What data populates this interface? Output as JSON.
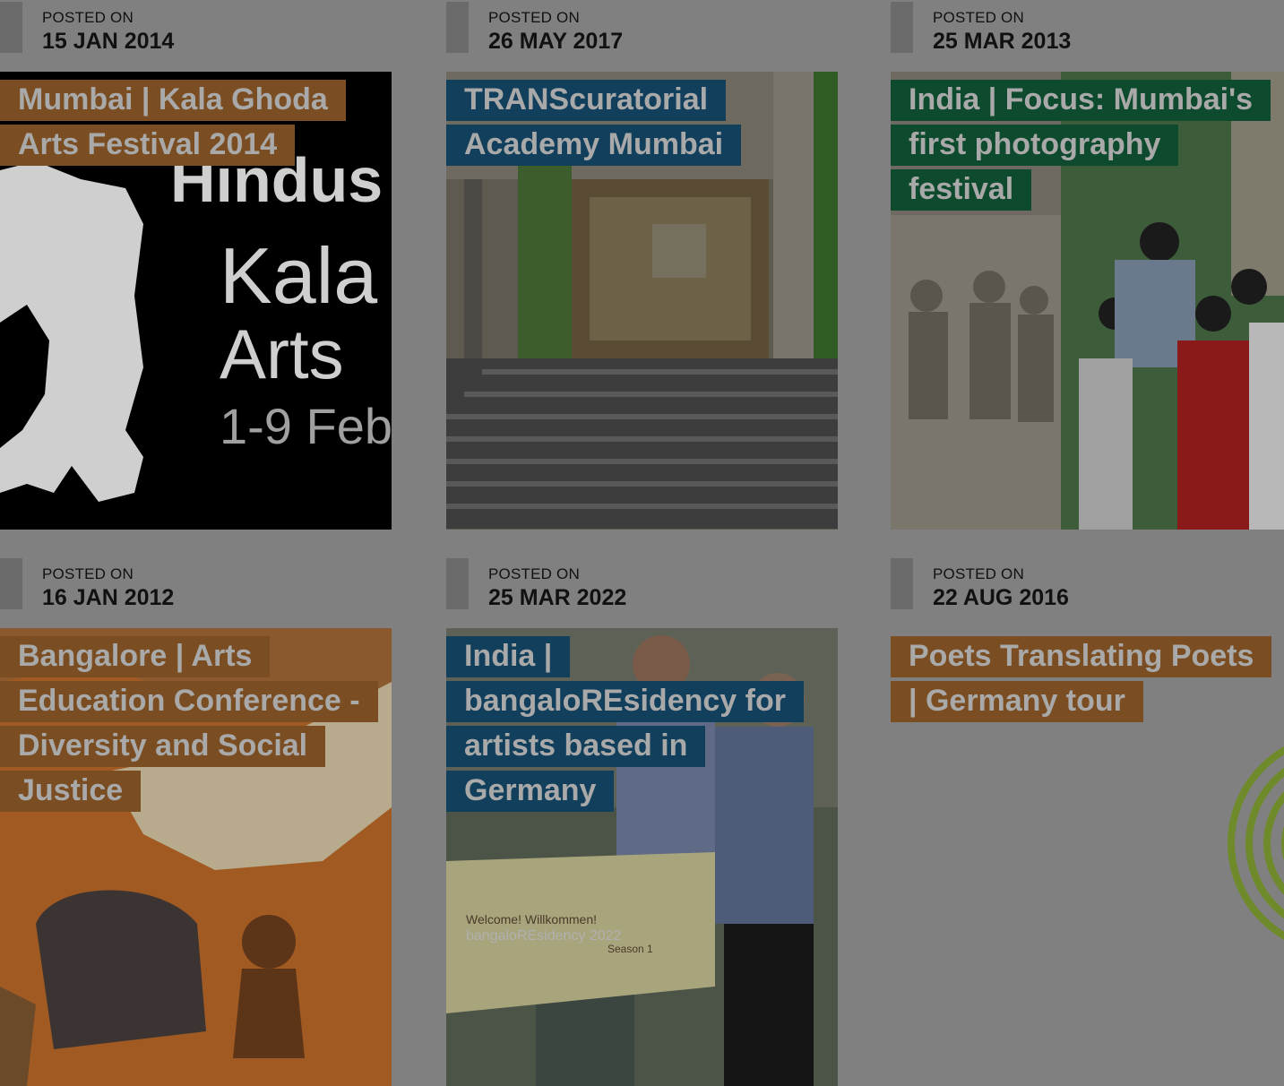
{
  "posted_label": "POSTED ON",
  "colors": {
    "brown": "#7a4e22",
    "blue": "#113f5c",
    "green": "#0e4a2d",
    "overlay": "#808080"
  },
  "posts": [
    {
      "date": "15 JAN 2014",
      "title": "Mumbai | Kala Ghoda Arts Festival 2014",
      "tag_color": "brown",
      "image_text": [
        "Hindus",
        "Kala",
        "Arts",
        "1-9 Feb"
      ]
    },
    {
      "date": "26 MAY 2017",
      "title": "TRANScuratorial Academy Mumbai",
      "tag_color": "blue"
    },
    {
      "date": "25 MAR 2013",
      "title": "India | Focus: Mumbai's first photography festival",
      "tag_color": "green"
    },
    {
      "date": "16 JAN 2012",
      "title": "Bangalore | Arts Education Conference - Diversity and Social Justice",
      "tag_color": "brown"
    },
    {
      "date": "25 MAR 2022",
      "title": "India | bangaloREsidency for artists based in Germany",
      "tag_color": "blue",
      "image_text": [
        "Welcome! Willkommen!",
        "bangaloREsidency 2022",
        "Season 1"
      ]
    },
    {
      "date": "22 AUG 2016",
      "title": "Poets Translating Poets | Germany tour",
      "tag_color": "brown"
    }
  ]
}
